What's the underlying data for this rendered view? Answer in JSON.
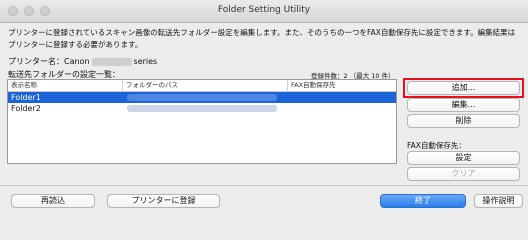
{
  "window": {
    "title": "Folder Setting Utility"
  },
  "description": "プリンターに登録されているスキャン画像の転送先フォルダー設定を編集します。また、そのうちの一つをFAX自動保存先に設定できます。編集結果はプリンターに登録する必要があります。",
  "printer": {
    "prefix": "プリンター名：Canon",
    "suffix": "series"
  },
  "list": {
    "title": "転送先フォルダーの設定一覧：",
    "count": "登録件数：2 （最大 10 件）",
    "headers": [
      "表示名称",
      "フォルダーのパス",
      "FAX自動保存先"
    ],
    "rows": [
      {
        "name": "Folder1",
        "selected": true
      },
      {
        "name": "Folder2",
        "selected": false
      }
    ]
  },
  "side_buttons": {
    "add": "追加...",
    "edit": "編集...",
    "delete": "削除"
  },
  "fax": {
    "label": "FAX自動保存先：",
    "set": "設定",
    "clear": "クリア"
  },
  "bottom": {
    "reload": "再読込",
    "register": "プリンターに登録",
    "done": "終了",
    "help": "操作説明"
  },
  "colors": {
    "selection": "#1a63d9",
    "highlight": "#e8111b",
    "primary": "#2a7de9"
  }
}
